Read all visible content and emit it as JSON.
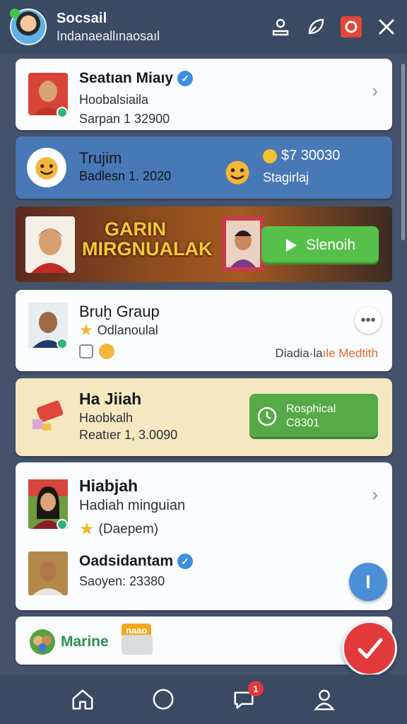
{
  "header": {
    "title": "Socsail",
    "subtitle": "Indanaeallınaosaıl",
    "icons": [
      "profile-icon",
      "leaf-icon",
      "record-icon",
      "close-icon"
    ]
  },
  "card1": {
    "name": "Seatıan Miaıy",
    "line1": "Hoobalsiaila",
    "line2": "Sarpan 1 32900"
  },
  "card2": {
    "name": "Trujim",
    "line1": "Badlesn 1. 2020",
    "amount": "$7 30030",
    "amount_label": "Stagirlaj"
  },
  "banner": {
    "title_line1": "GARIN",
    "title_line2": "MIRGNUALAK",
    "button_label": "Slenoih"
  },
  "card4": {
    "name": "Bruḫ Graup",
    "line1": "Odlanoulal",
    "footer_prefix": "Diadia·la",
    "footer_highlight": "ıle Medtith"
  },
  "card5": {
    "name": "Ha Jiiah",
    "line1": "Haobkalh",
    "line2": "Reatıer 1, 3.0090",
    "button_line1": "Rosphical",
    "button_line2": "C8301"
  },
  "card6": {
    "name": "Hiabjah",
    "line1": "Hadiah minguian",
    "line2": "(Daepem)",
    "sub_name": "Oadsidantam",
    "sub_line": "Saoyen: 23380"
  },
  "card7": {
    "name": "Marine",
    "tag": "naao"
  },
  "fab_blue_label": "I",
  "nav": {
    "items": [
      "home-icon",
      "circle-icon",
      "chat-icon",
      "account-icon"
    ],
    "chat_badge": "1"
  },
  "colors": {
    "header_bg": "#3a4a63",
    "blue_card": "#4878b6",
    "cream_card": "#f5e7c0",
    "green_button": "#55a947",
    "red_fab": "#e2393a",
    "accent_orange": "#e0682a"
  }
}
